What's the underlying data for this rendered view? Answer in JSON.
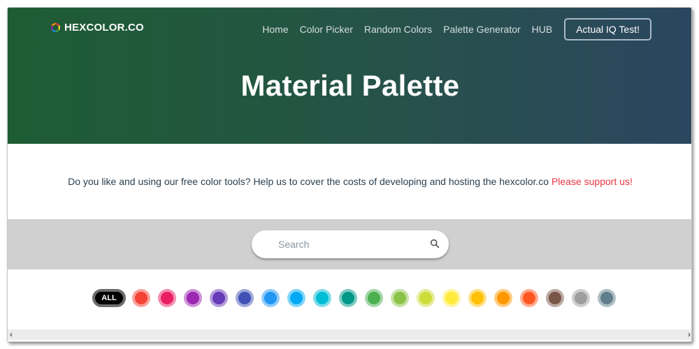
{
  "header": {
    "logo_text": "HEXCOLOR.CO",
    "nav": [
      {
        "label": "Home"
      },
      {
        "label": "Color Picker"
      },
      {
        "label": "Random Colors"
      },
      {
        "label": "Palette Generator"
      },
      {
        "label": "HUB"
      }
    ],
    "cta_label": "Actual IQ Test!",
    "title": "Material Palette",
    "gradient": {
      "start": "#1e5c34",
      "end": "#2b4660"
    }
  },
  "support": {
    "text": "Do you like and using our free color tools? Help us to cover the costs of developing and hosting the hexcolor.co",
    "link_text": "Please support us!",
    "link_color": "#e8353f"
  },
  "search": {
    "placeholder": "Search",
    "value": "",
    "icon": "search-icon"
  },
  "filters": {
    "all_label": "ALL",
    "colors": [
      {
        "name": "red",
        "hex": "#f44336"
      },
      {
        "name": "pink",
        "hex": "#e91e63"
      },
      {
        "name": "purple",
        "hex": "#9c27b0"
      },
      {
        "name": "deep-purple",
        "hex": "#673ab7"
      },
      {
        "name": "indigo",
        "hex": "#3f51b5"
      },
      {
        "name": "blue",
        "hex": "#2196f3"
      },
      {
        "name": "light-blue",
        "hex": "#03a9f4"
      },
      {
        "name": "cyan",
        "hex": "#00bcd4"
      },
      {
        "name": "teal",
        "hex": "#009688"
      },
      {
        "name": "green",
        "hex": "#4caf50"
      },
      {
        "name": "light-green",
        "hex": "#8bc34a"
      },
      {
        "name": "lime",
        "hex": "#cddc39"
      },
      {
        "name": "yellow",
        "hex": "#ffeb3b"
      },
      {
        "name": "amber",
        "hex": "#ffc107"
      },
      {
        "name": "orange",
        "hex": "#ff9800"
      },
      {
        "name": "deep-orange",
        "hex": "#ff5722"
      },
      {
        "name": "brown",
        "hex": "#795548"
      },
      {
        "name": "grey",
        "hex": "#9e9e9e"
      },
      {
        "name": "blue-grey",
        "hex": "#607d8b"
      }
    ]
  },
  "scrollbar": {
    "left_arrow": "‹",
    "right_arrow": "›"
  }
}
